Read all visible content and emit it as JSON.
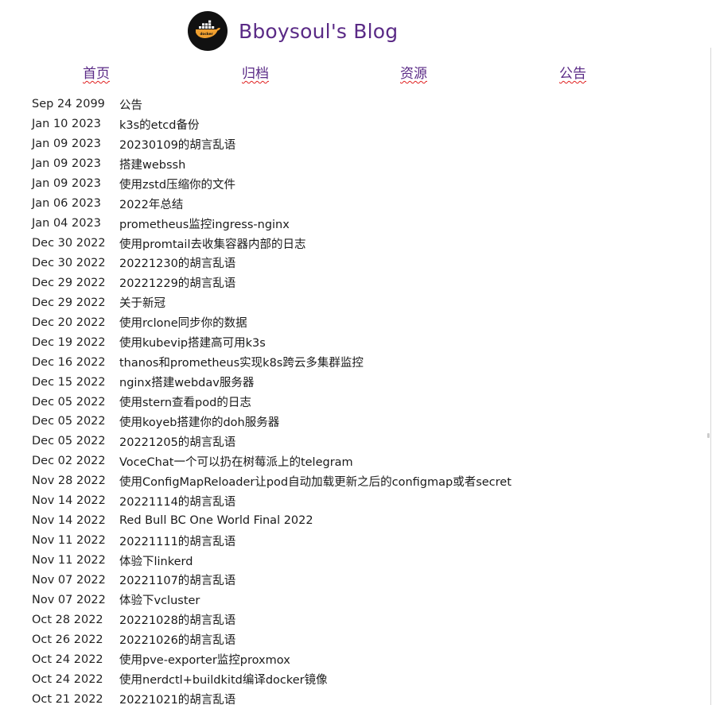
{
  "site": {
    "title": "Bboysoul's Blog",
    "logo_icon": "docker-whale-icon",
    "logo_text": "docker"
  },
  "nav": {
    "items": [
      "首页",
      "归档",
      "资源",
      "公告"
    ]
  },
  "posts": [
    {
      "date": "Sep 24 2099",
      "title": "公告"
    },
    {
      "date": "Jan 10 2023",
      "title": "k3s的etcd备份"
    },
    {
      "date": "Jan 09 2023",
      "title": "20230109的胡言乱语"
    },
    {
      "date": "Jan 09 2023",
      "title": "搭建webssh"
    },
    {
      "date": "Jan 09 2023",
      "title": "使用zstd压缩你的文件"
    },
    {
      "date": "Jan 06 2023",
      "title": "2022年总结"
    },
    {
      "date": "Jan 04 2023",
      "title": "prometheus监控ingress-nginx"
    },
    {
      "date": "Dec 30 2022",
      "title": "使用promtail去收集容器内部的日志"
    },
    {
      "date": "Dec 30 2022",
      "title": "20221230的胡言乱语"
    },
    {
      "date": "Dec 29 2022",
      "title": "20221229的胡言乱语"
    },
    {
      "date": "Dec 29 2022",
      "title": "关于新冠"
    },
    {
      "date": "Dec 20 2022",
      "title": "使用rclone同步你的数据"
    },
    {
      "date": "Dec 19 2022",
      "title": "使用kubevip搭建高可用k3s"
    },
    {
      "date": "Dec 16 2022",
      "title": "thanos和prometheus实现k8s跨云多集群监控"
    },
    {
      "date": "Dec 15 2022",
      "title": "nginx搭建webdav服务器"
    },
    {
      "date": "Dec 05 2022",
      "title": "使用stern查看pod的日志"
    },
    {
      "date": "Dec 05 2022",
      "title": "使用koyeb搭建你的doh服务器"
    },
    {
      "date": "Dec 05 2022",
      "title": "20221205的胡言乱语"
    },
    {
      "date": "Dec 02 2022",
      "title": "VoceChat一个可以扔在树莓派上的telegram"
    },
    {
      "date": "Nov 28 2022",
      "title": "使用ConfigMapReloader让pod自动加载更新之后的configmap或者secret"
    },
    {
      "date": "Nov 14 2022",
      "title": "20221114的胡言乱语"
    },
    {
      "date": "Nov 14 2022",
      "title": "Red Bull BC One World Final 2022"
    },
    {
      "date": "Nov 11 2022",
      "title": "20221111的胡言乱语"
    },
    {
      "date": "Nov 11 2022",
      "title": "体验下linkerd"
    },
    {
      "date": "Nov 07 2022",
      "title": "20221107的胡言乱语"
    },
    {
      "date": "Nov 07 2022",
      "title": "体验下vcluster"
    },
    {
      "date": "Oct 28 2022",
      "title": "20221028的胡言乱语"
    },
    {
      "date": "Oct 26 2022",
      "title": "20221026的胡言乱语"
    },
    {
      "date": "Oct 24 2022",
      "title": "使用pve-exporter监控proxmox"
    },
    {
      "date": "Oct 24 2022",
      "title": "使用nerdctl+buildkitd编译docker镜像"
    },
    {
      "date": "Oct 21 2022",
      "title": "20221021的胡言乱语"
    }
  ],
  "colors": {
    "title": "#5a2a86",
    "nav_underline": "#e02020",
    "logo_bg": "#111111",
    "logo_accent": "#f0a030"
  }
}
